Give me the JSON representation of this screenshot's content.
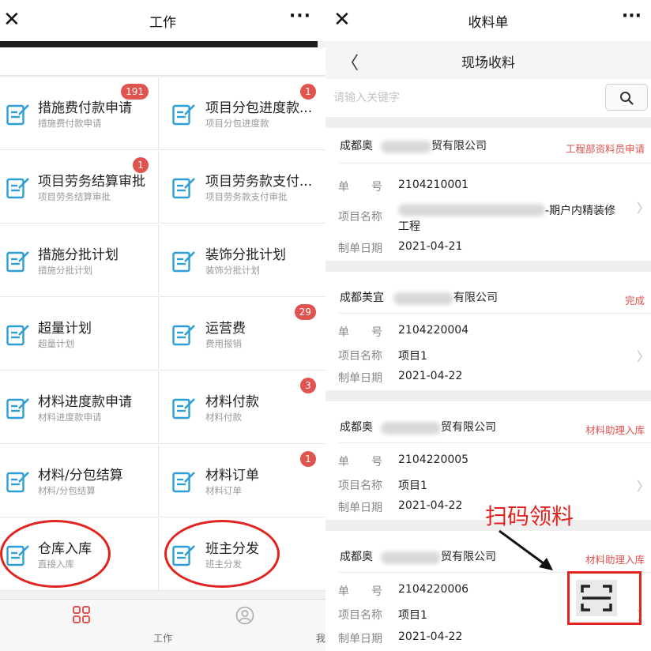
{
  "left": {
    "title": "工作",
    "close_glyph": "✕",
    "more_glyph": "···",
    "grid": [
      {
        "title": "措施费付款申请",
        "subtitle": "措施费付款申请",
        "badge": "191"
      },
      {
        "title": "项目分包进度款...",
        "subtitle": "项目分包进度款",
        "badge": "1"
      },
      {
        "title": "项目劳务结算审批",
        "subtitle": "项目劳务结算审批",
        "badge": "1"
      },
      {
        "title": "项目劳务款支付...",
        "subtitle": "项目劳务款支付审批",
        "badge": ""
      },
      {
        "title": "措施分批计划",
        "subtitle": "措施分批计划",
        "badge": ""
      },
      {
        "title": "装饰分批计划",
        "subtitle": "装饰分批计划",
        "badge": ""
      },
      {
        "title": "超量计划",
        "subtitle": "超量计划",
        "badge": ""
      },
      {
        "title": "运营费",
        "subtitle": "费用报销",
        "badge": "29"
      },
      {
        "title": "材料进度款申请",
        "subtitle": "材料进度款申请",
        "badge": ""
      },
      {
        "title": "材料付款",
        "subtitle": "材料付款",
        "badge": "3"
      },
      {
        "title": "材料/分包结算",
        "subtitle": "材料/分包结算",
        "badge": ""
      },
      {
        "title": "材料订单",
        "subtitle": "材料订单",
        "badge": "1"
      },
      {
        "title": "仓库入库",
        "subtitle": "直接入库",
        "badge": ""
      },
      {
        "title": "班主分发",
        "subtitle": "班主分发",
        "badge": ""
      }
    ],
    "tabs": {
      "work": "工作",
      "mine": "我的"
    }
  },
  "right": {
    "title": "收料单",
    "close_glyph": "✕",
    "more_glyph": "···",
    "subtitle": "现场收料",
    "back_glyph": "〈",
    "search_placeholder": "请输入关键字",
    "labels": {
      "number": "单　　号",
      "project": "项目名称",
      "date": "制单日期"
    },
    "chevron": "〉",
    "cards": [
      {
        "company_a": "成都奥",
        "company_b": "贸有限公司",
        "status": "工程部资料员申请",
        "number": "2104210001",
        "project_a": "",
        "project_b": "-期户内精装修",
        "project_c": "工程",
        "date": "2021-04-21"
      },
      {
        "company_a": "成都美宜",
        "company_b": "有限公司",
        "status": "完成",
        "number": "2104220004",
        "project_a": "项目1",
        "project_b": "",
        "project_c": "",
        "date": "2021-04-22"
      },
      {
        "company_a": "成都奥",
        "company_b": "贸有限公司",
        "status": "材料助理入库",
        "number": "2104220005",
        "project_a": "项目1",
        "project_b": "",
        "project_c": "",
        "date": "2021-04-22"
      },
      {
        "company_a": "成都奥",
        "company_b": "贸有限公司",
        "status": "材料助理入库",
        "number": "2104220006",
        "project_a": "项目1",
        "project_b": "",
        "project_c": "",
        "date": "2021-04-22"
      }
    ],
    "annotation": "扫码领料"
  },
  "colors": {
    "accent_red": "#e0534f",
    "ring_red": "#e0231f",
    "icon_blue": "#2e9ed6"
  }
}
